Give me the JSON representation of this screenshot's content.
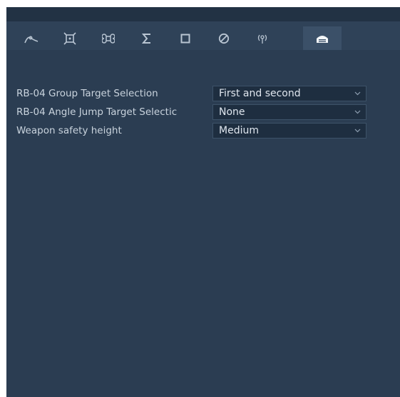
{
  "tabs": [
    {
      "icon": "path-icon",
      "active": false
    },
    {
      "icon": "drone-target-icon",
      "active": false
    },
    {
      "icon": "command-icon",
      "active": false
    },
    {
      "icon": "sigma-icon",
      "active": false
    },
    {
      "icon": "square-icon",
      "active": false
    },
    {
      "icon": "prohibited-icon",
      "active": false
    },
    {
      "icon": "radio-signal-icon",
      "active": false
    },
    {
      "icon": "hangar-icon",
      "active": true
    }
  ],
  "settings": [
    {
      "label": "RB-04 Group Target Selection",
      "value": "First and second"
    },
    {
      "label": "RB-04 Angle Jump Target Selectic",
      "value": "None"
    },
    {
      "label": "Weapon safety height",
      "value": "Medium"
    }
  ],
  "colors": {
    "panel_bg": "#2b3d52",
    "tabbar_bg": "#2f4258",
    "active_tab_bg": "#3b5068",
    "field_bg": "#1e2e40",
    "text": "#c9d3dd"
  }
}
